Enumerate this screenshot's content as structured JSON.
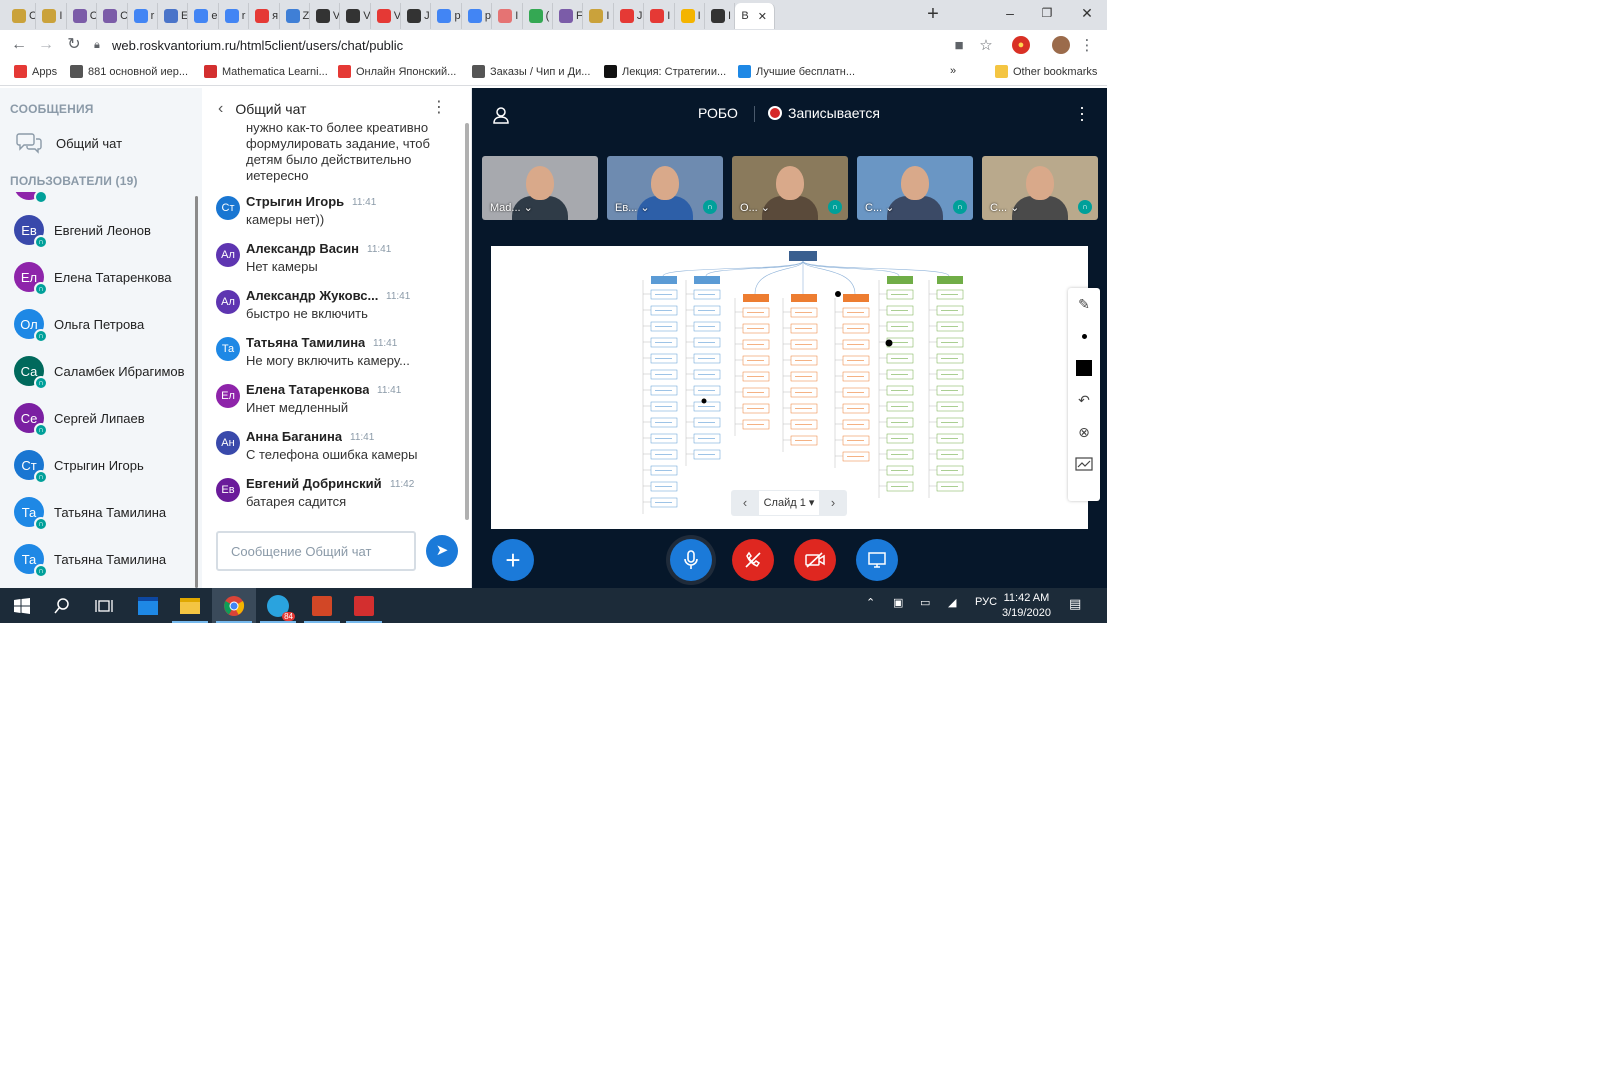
{
  "browser": {
    "tabs": [
      {
        "letter": "C",
        "color": "#caa23b"
      },
      {
        "letter": "I",
        "color": "#caa23b"
      },
      {
        "letter": "C",
        "color": "#7b5ca8"
      },
      {
        "letter": "C",
        "color": "#7b5ca8"
      },
      {
        "letter": "r",
        "color": "#4285f4"
      },
      {
        "letter": "E",
        "color": "#4a74c9"
      },
      {
        "letter": "e",
        "color": "#4285f4"
      },
      {
        "letter": "r",
        "color": "#4285f4"
      },
      {
        "letter": "я",
        "color": "#e53935"
      },
      {
        "letter": "Z",
        "color": "#3f7fd6"
      },
      {
        "letter": "V",
        "color": "#333333"
      },
      {
        "letter": "V",
        "color": "#333333"
      },
      {
        "letter": "V",
        "color": "#e53935"
      },
      {
        "letter": "J",
        "color": "#333333"
      },
      {
        "letter": "p",
        "color": "#4285f4"
      },
      {
        "letter": "p",
        "color": "#4285f4"
      },
      {
        "letter": "I",
        "color": "#e57373"
      },
      {
        "letter": "(",
        "color": "#34a853"
      },
      {
        "letter": "F",
        "color": "#7b5ca8"
      },
      {
        "letter": "I",
        "color": "#caa23b"
      },
      {
        "letter": "J",
        "color": "#e53935"
      },
      {
        "letter": "I",
        "color": "#e53935"
      },
      {
        "letter": "I",
        "color": "#f4b400"
      },
      {
        "letter": "I",
        "color": "#333333"
      }
    ],
    "active_tab": "B",
    "new_tab": "+",
    "win_min": "–",
    "win_max": "❐",
    "win_close": "✕",
    "url": "web.roskvantorium.ru/html5client/users/chat/public",
    "bookmarks": [
      {
        "label": "Apps",
        "color": "#e53935"
      },
      {
        "label": "881 основной иер...",
        "color": "#555555"
      },
      {
        "label": "Mathematica Learni...",
        "color": "#d32f2f"
      },
      {
        "label": "Онлайн Японский...",
        "color": "#e53935"
      },
      {
        "label": "Заказы / Чип и Ди...",
        "color": "#555555"
      },
      {
        "label": "Лекция: Стратегии...",
        "color": "#111111"
      },
      {
        "label": "Лучшие бесплатн...",
        "color": "#1e88e5"
      }
    ],
    "bookmarks_overflow": "»",
    "other_bookmarks": "Other bookmarks"
  },
  "sidebar": {
    "messages_heading": "СООБЩЕНИЯ",
    "public_chat": "Общий чат",
    "users_heading": "ПОЛЬЗОВАТЕЛИ (19)",
    "users": [
      {
        "initials": "Ев",
        "name": "Евгений Леонов",
        "color": "#3949ab"
      },
      {
        "initials": "Ел",
        "name": "Елена Татаренкова",
        "color": "#8e24aa"
      },
      {
        "initials": "Ол",
        "name": "Ольга Петрова",
        "color": "#1e88e5"
      },
      {
        "initials": "Са",
        "name": "Саламбек Ибрагимов",
        "color": "#00695c"
      },
      {
        "initials": "Се",
        "name": "Сергей Липаев",
        "color": "#7b1fa2"
      },
      {
        "initials": "Ст",
        "name": "Стрыгин Игорь",
        "color": "#1976d2"
      },
      {
        "initials": "Та",
        "name": "Татьяна Тамилина",
        "color": "#1e88e5"
      },
      {
        "initials": "Та",
        "name": "Татьяна Тамилина",
        "color": "#1e88e5"
      }
    ]
  },
  "chat": {
    "title": "Общий чат",
    "continuation": [
      "нужно как-то более креативно",
      "формулировать задание, чтоб",
      "детям было действительно",
      "иетересно"
    ],
    "messages": [
      {
        "initials": "Ст",
        "name": "Стрыгин Игорь",
        "time": "11:41",
        "text": "камеры нет))",
        "color": "#1976d2"
      },
      {
        "initials": "Ал",
        "name": "Александр Васин",
        "time": "11:41",
        "text": "Нет камеры",
        "color": "#5e35b1"
      },
      {
        "initials": "Ал",
        "name": "Александр Жуковс...",
        "time": "11:41",
        "text": "быстро не включить",
        "color": "#5e35b1"
      },
      {
        "initials": "Та",
        "name": "Татьяна Тамилина",
        "time": "11:41",
        "text": "Не могу включить камеру...",
        "color": "#1e88e5"
      },
      {
        "initials": "Ел",
        "name": "Елена Татаренкова",
        "time": "11:41",
        "text": "Инет медленный",
        "color": "#8e24aa"
      },
      {
        "initials": "Ан",
        "name": "Анна Баганина",
        "time": "11:41",
        "text": "С телефона ошибка камеры",
        "color": "#3949ab"
      },
      {
        "initials": "Ев",
        "name": "Евгений Добринский",
        "time": "11:42",
        "text": "батарея садится",
        "color": "#6a1b9a"
      }
    ],
    "input_placeholder": "Сообщение Общий чат"
  },
  "presentation": {
    "room_title": "РОБО",
    "recording_label": "Записывается",
    "videos": [
      {
        "name": "Mad...",
        "bg": "#a7a9ae",
        "shirt": "#2f3b47",
        "headset": false
      },
      {
        "name": "Ев...",
        "bg": "#6e8bb0",
        "shirt": "#2d5fa8",
        "headset": true
      },
      {
        "name": "О...",
        "bg": "#8a7a5c",
        "shirt": "#5a4a3a",
        "headset": true
      },
      {
        "name": "С...",
        "bg": "#6a96c4",
        "shirt": "#3b4a66",
        "headset": true
      },
      {
        "name": "С...",
        "bg": "#b9a98c",
        "shirt": "#4a4a4a",
        "headset": true
      }
    ],
    "slide_label": "Слайд 1",
    "slide_caret": "▾",
    "prev": "‹",
    "next": "›"
  },
  "taskbar": {
    "lang": "РУС",
    "time": "11:42 AM",
    "date": "3/19/2020",
    "telegram_badge": "84"
  },
  "colors": {
    "accent": "#1b7ad9",
    "danger": "#df2720",
    "pres_bg": "#06172a",
    "sidebar_bg": "#f3f6f9"
  }
}
